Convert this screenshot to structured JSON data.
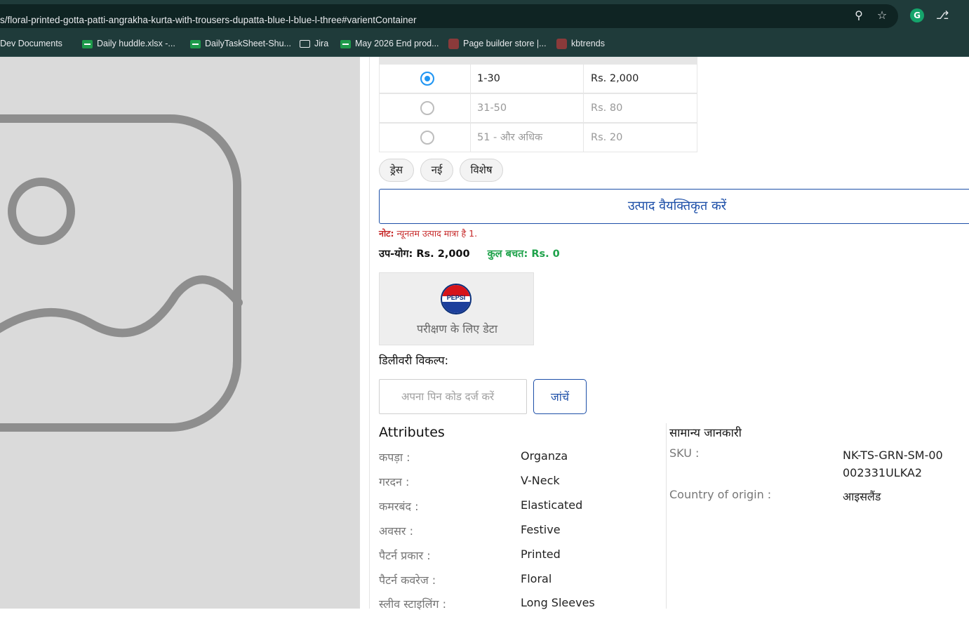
{
  "browser": {
    "url": "s/floral-printed-gotta-patti-angrakha-kurta-with-trousers-dupatta-blue-l-blue-l-three#varientContainer",
    "bookmarks": [
      {
        "label": "Dev Documents",
        "icon": "folder-icon"
      },
      {
        "label": "Daily huddle.xlsx -...",
        "icon": "sheet-icon"
      },
      {
        "label": "DailyTaskSheet-Shu...",
        "icon": "sheet-icon"
      },
      {
        "label": "Jira",
        "icon": "folder-icon"
      },
      {
        "label": "May 2026 End prod...",
        "icon": "sheet-icon"
      },
      {
        "label": "Page builder store |...",
        "icon": "store-favicon"
      },
      {
        "label": "kbtrends",
        "icon": "store-favicon"
      }
    ]
  },
  "pricing_tiers": [
    {
      "range": "1-30",
      "price": "Rs. 2,000",
      "selected": true
    },
    {
      "range": "31-50",
      "price": "Rs. 80",
      "selected": false
    },
    {
      "range": "51 - और अधिक",
      "price": "Rs. 20",
      "selected": false
    }
  ],
  "tags": [
    "ड्रेस",
    "नई",
    "विशेष"
  ],
  "personalize_label": "उत्पाद वैयक्तिकृत करें",
  "note": {
    "prefix": "नोट:",
    "text": " न्यूनतम उत्पाद मात्रा है 1."
  },
  "totals": {
    "subtotal_label": "उप-योग:",
    "subtotal_value": "Rs. 2,000",
    "savings_label": "कुल बचत:",
    "savings_value": "Rs. 0"
  },
  "brand": {
    "logo_text": "PEPSI",
    "label": "परीक्षण के लिए डेटा"
  },
  "delivery": {
    "title": "डिलीवरी विकल्प:",
    "pin_placeholder": "अपना पिन कोड दर्ज करें",
    "check_label": "जांचें"
  },
  "attributes": {
    "title": "Attributes",
    "rows": [
      {
        "key": "कपड़ा :",
        "value": "Organza"
      },
      {
        "key": "गरदन :",
        "value": "V-Neck"
      },
      {
        "key": "कमरबंद :",
        "value": "Elasticated"
      },
      {
        "key": "अवसर :",
        "value": "Festive"
      },
      {
        "key": "पैटर्न प्रकार :",
        "value": "Printed"
      },
      {
        "key": "पैटर्न कवरेज :",
        "value": "Floral"
      },
      {
        "key": "स्लीव स्टाइलिंग :",
        "value": "Long Sleeves"
      }
    ]
  },
  "general_info": {
    "title": "सामान्य जानकारी",
    "rows": [
      {
        "key": "SKU :",
        "value": "NK-TS-GRN-SM-00002331ULKA2"
      },
      {
        "key": "Country of origin :",
        "value": "आइसलैंड"
      }
    ]
  },
  "colors": {
    "accent": "#1d4fa8",
    "radio_selected": "#2196f3",
    "savings": "#1ea24a",
    "note": "#c62828"
  }
}
